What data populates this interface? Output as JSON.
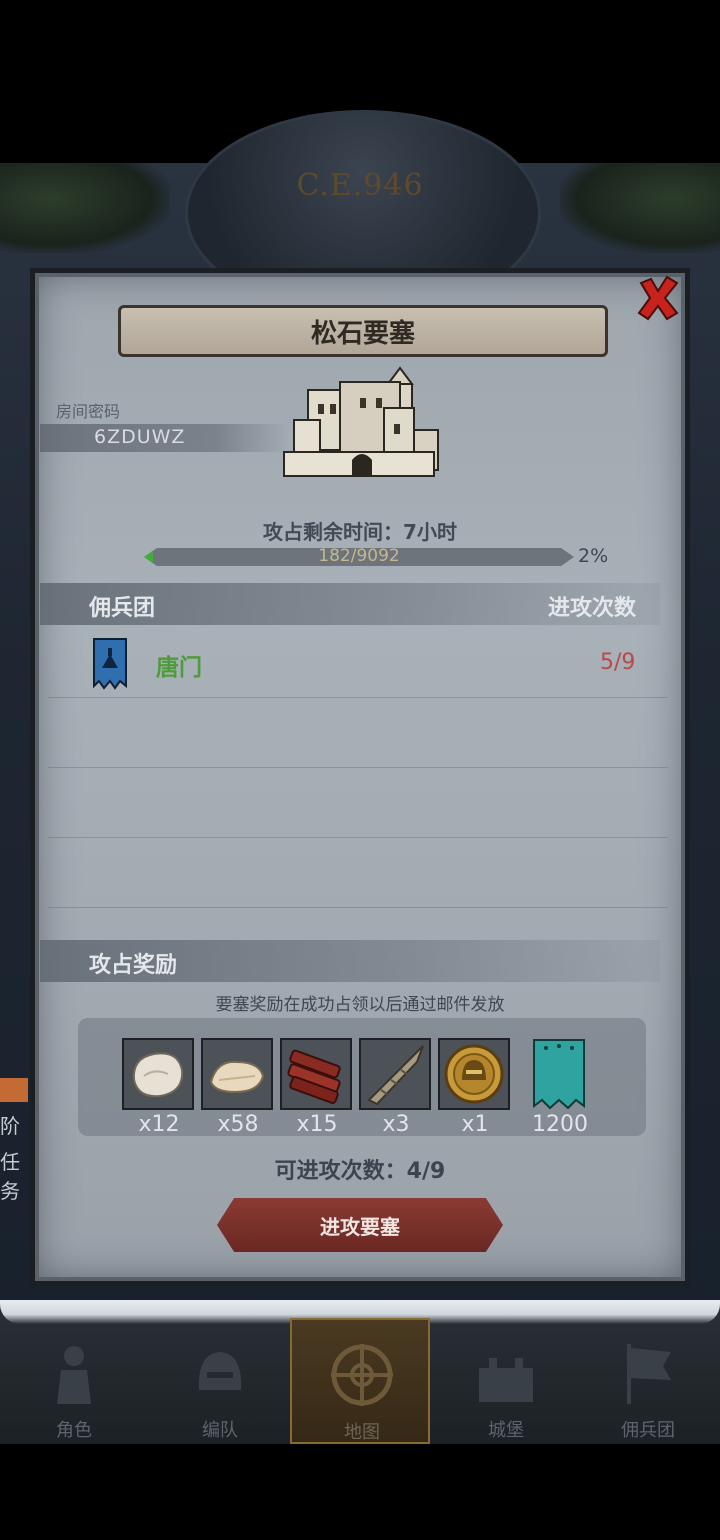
{
  "header": {
    "era_label": "C.E.946"
  },
  "dialog": {
    "title": "松石要塞",
    "room_label": "房间密码",
    "room_code": "6ZDUWZ",
    "time_remaining": "攻占剩余时间：7小时",
    "progress": {
      "text": "182/9092",
      "current": 182,
      "total": 9092,
      "percent_text": "2%"
    },
    "mercenary_header": "佣兵团",
    "attack_count_header": "进攻次数",
    "mercenaries": [
      {
        "name": "唐门",
        "count": "5/9",
        "flag_color": "#2f6fb0",
        "name_color": "#4f9b3a"
      }
    ],
    "reward_header": "攻占奖励",
    "reward_note": "要塞奖励在成功占领以后通过邮件发放",
    "rewards": [
      {
        "icon": "hide-icon",
        "qty": "x12"
      },
      {
        "icon": "fur-icon",
        "qty": "x58"
      },
      {
        "icon": "wood-icon",
        "qty": "x15"
      },
      {
        "icon": "horn-icon",
        "qty": "x3"
      },
      {
        "icon": "helmet-medal-icon",
        "qty": "x1"
      },
      {
        "icon": "guild-banner-icon",
        "qty": "1200"
      }
    ],
    "attacks_left": "可进攻次数：4/9",
    "attack_button": "进攻要塞"
  },
  "side": {
    "labels": [
      "阶",
      "任务"
    ]
  },
  "nav": {
    "items": [
      {
        "label": "角色",
        "icon": "knight-icon"
      },
      {
        "label": "编队",
        "icon": "helmet-icon"
      },
      {
        "label": "地图",
        "icon": "compass-icon",
        "active": true
      },
      {
        "label": "城堡",
        "icon": "castle-icon"
      },
      {
        "label": "佣兵团",
        "icon": "banner-icon"
      }
    ]
  },
  "colors": {
    "accent_red": "#8b3a33",
    "count_red": "#b84a4a",
    "merc_green": "#4f9b3a",
    "progress_green": "#3fae3a"
  }
}
